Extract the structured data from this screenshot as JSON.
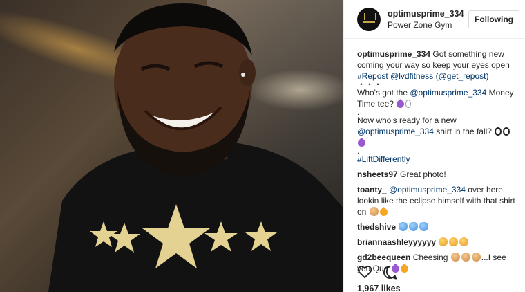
{
  "post": {
    "username": "optimusprime_334",
    "location": "Power Zone Gym",
    "follow_label": "Following",
    "likes": "1,967 likes"
  },
  "caption": {
    "username": "optimusprime_334",
    "line1": "Got something new coming your way so keep your eyes open",
    "repost_tag": "#Repost",
    "mention1": "@lvdfitness",
    "mention2": "(@get_repost)",
    "dots": "・・・",
    "q1_a": "Who's got the",
    "q1_mention": "@optimusprime_334",
    "q1_b": "Money Time tee?",
    "dot2": ".",
    "q2_a": "Now who's ready for a new",
    "q2_mention": "@optimusprime_334",
    "q2_b": "shirt in the fall?",
    "dot3": ".",
    "hashtag": "#LiftDifferently"
  },
  "comments": [
    {
      "username": "nsheets97",
      "text": "Great photo!"
    },
    {
      "username": "toanty_",
      "mention": "@optimusprime_334",
      "text": "over here lookin like the eclipse himself with that shirt on"
    },
    {
      "username": "thedshive",
      "text": ""
    },
    {
      "username": "briannaashleyyyyyy",
      "text": ""
    },
    {
      "username": "gd2beequeen",
      "text_a": "Cheesing",
      "text_b": "...I see you Que"
    }
  ],
  "icons": {
    "like": "heart-outline-icon",
    "comment": "speech-bubble-icon"
  }
}
